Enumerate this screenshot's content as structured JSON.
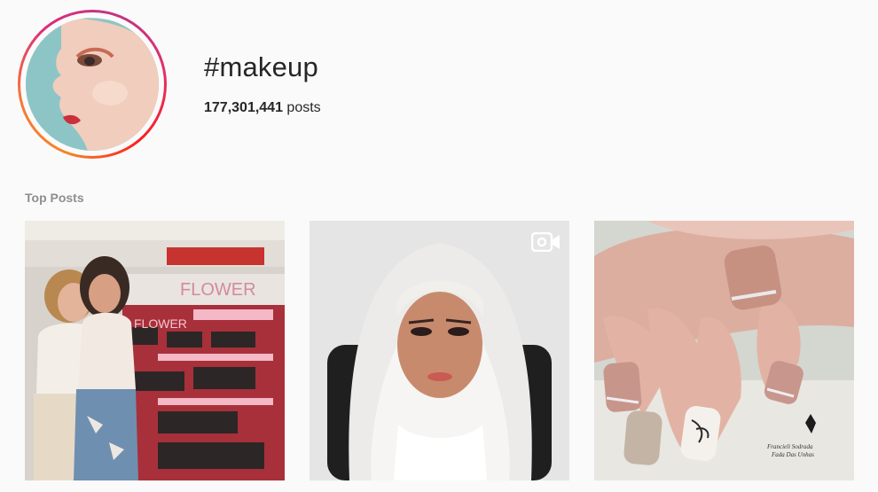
{
  "header": {
    "hashtag": "#makeup",
    "post_count_number": "177,301,441",
    "post_count_suffix": " posts"
  },
  "top_posts": {
    "label": "Top Posts",
    "posts": [
      {
        "type": "photo",
        "store_sign": "FLOWER",
        "store_sign_2": "FLOWER"
      },
      {
        "type": "video",
        "icon": "video-camera-icon"
      },
      {
        "type": "photo",
        "watermark_line1": "Francieli Sodrada",
        "watermark_line2": "Fada Das Unhas"
      }
    ]
  },
  "colors": {
    "ring_gradient": [
      "#f58529",
      "#dd2a7b",
      "#c13584"
    ],
    "muted_text": "#8e8e8e",
    "background": "#fafafa"
  }
}
